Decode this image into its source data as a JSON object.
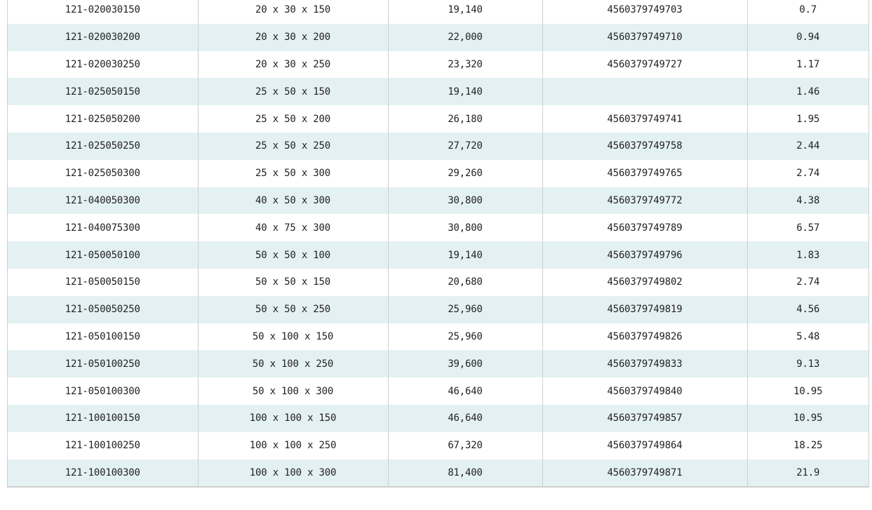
{
  "rows": [
    {
      "code": "121-020030150",
      "size": "20 x 30 x 150",
      "price": "19,140",
      "jan": "4560379749703",
      "weight": "0.7"
    },
    {
      "code": "121-020030200",
      "size": "20 x 30 x 200",
      "price": "22,000",
      "jan": "4560379749710",
      "weight": "0.94"
    },
    {
      "code": "121-020030250",
      "size": "20 x 30 x 250",
      "price": "23,320",
      "jan": "4560379749727",
      "weight": "1.17"
    },
    {
      "code": "121-025050150",
      "size": "25 x 50 x 150",
      "price": "19,140",
      "jan": "",
      "weight": "1.46"
    },
    {
      "code": "121-025050200",
      "size": "25 x 50 x 200",
      "price": "26,180",
      "jan": "4560379749741",
      "weight": "1.95"
    },
    {
      "code": "121-025050250",
      "size": "25 x 50 x 250",
      "price": "27,720",
      "jan": "4560379749758",
      "weight": "2.44"
    },
    {
      "code": "121-025050300",
      "size": "25 x 50 x 300",
      "price": "29,260",
      "jan": "4560379749765",
      "weight": "2.74"
    },
    {
      "code": "121-040050300",
      "size": "40 x 50 x 300",
      "price": "30,800",
      "jan": "4560379749772",
      "weight": "4.38"
    },
    {
      "code": "121-040075300",
      "size": "40 x 75 x 300",
      "price": "30,800",
      "jan": "4560379749789",
      "weight": "6.57"
    },
    {
      "code": "121-050050100",
      "size": "50 x 50 x 100",
      "price": "19,140",
      "jan": "4560379749796",
      "weight": "1.83"
    },
    {
      "code": "121-050050150",
      "size": "50 x 50 x 150",
      "price": "20,680",
      "jan": "4560379749802",
      "weight": "2.74"
    },
    {
      "code": "121-050050250",
      "size": "50 x 50 x 250",
      "price": "25,960",
      "jan": "4560379749819",
      "weight": "4.56"
    },
    {
      "code": "121-050100150",
      "size": "50 x 100 x 150",
      "price": "25,960",
      "jan": "4560379749826",
      "weight": "5.48"
    },
    {
      "code": "121-050100250",
      "size": "50 x 100 x 250",
      "price": "39,600",
      "jan": "4560379749833",
      "weight": "9.13"
    },
    {
      "code": "121-050100300",
      "size": "50 x 100 x 300",
      "price": "46,640",
      "jan": "4560379749840",
      "weight": "10.95"
    },
    {
      "code": "121-100100150",
      "size": "100 x 100 x 150",
      "price": "46,640",
      "jan": "4560379749857",
      "weight": "10.95"
    },
    {
      "code": "121-100100250",
      "size": "100 x 100 x 250",
      "price": "67,320",
      "jan": "4560379749864",
      "weight": "18.25"
    },
    {
      "code": "121-100100300",
      "size": "100 x 100 x 300",
      "price": "81,400",
      "jan": "4560379749871",
      "weight": "21.9"
    }
  ]
}
